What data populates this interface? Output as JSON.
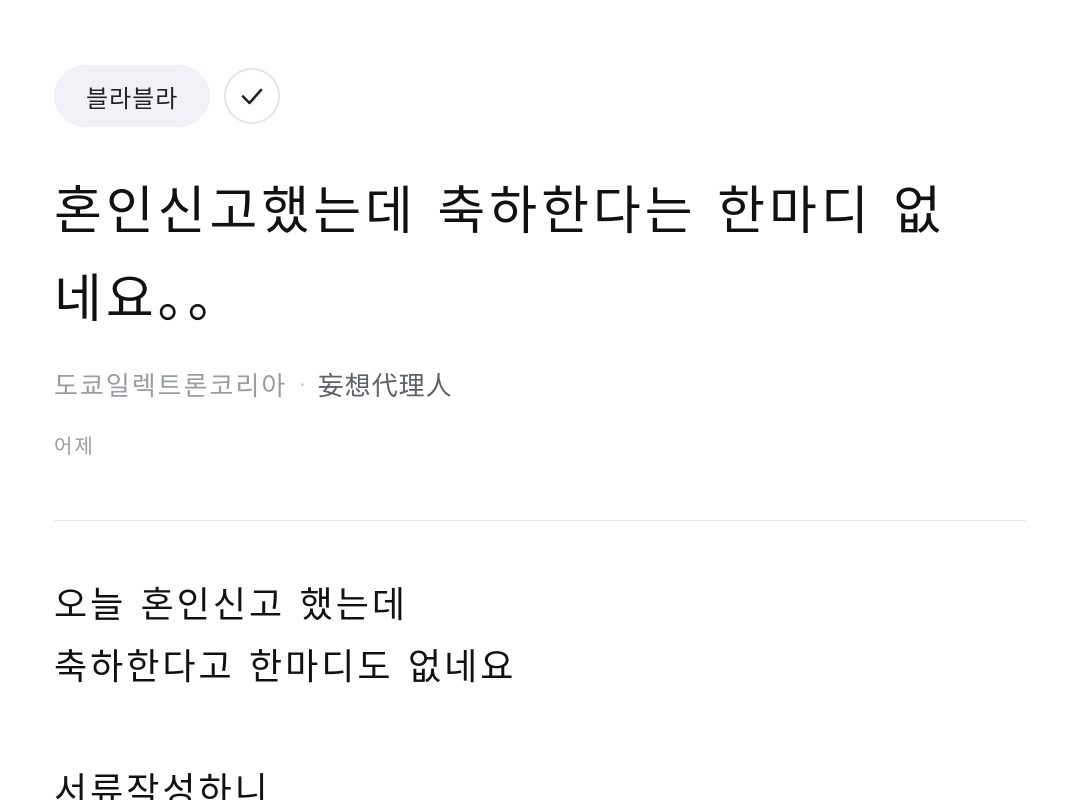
{
  "channel": {
    "label": "블라블라"
  },
  "post": {
    "title": "혼인신고했는데 축하한다는 한마디 없네요。。",
    "company": "도쿄일렉트론코리아",
    "separator": "·",
    "nickname": "妄想代理人",
    "date": "어제",
    "body": {
      "line1": "오늘 혼인신고 했는데",
      "line2": "축하한다고 한마디도 없네요",
      "line3": "서류작성하니"
    }
  },
  "icons": {
    "follow": "check-icon"
  }
}
